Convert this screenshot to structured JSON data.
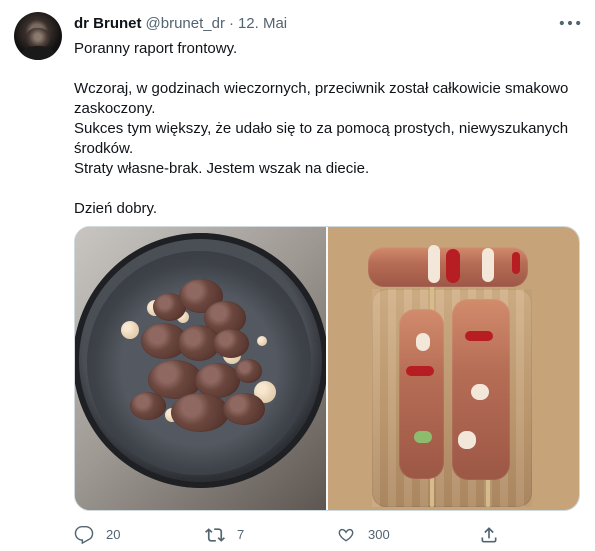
{
  "author": {
    "name": "dr Brunet",
    "handle": "@brunet_dr",
    "separator": "·",
    "date": "12. Mai"
  },
  "tweet": {
    "lines": [
      "Poranny raport frontowy.",
      "",
      "Wczoraj, w godzinach wieczornych, przeciwnik został całkowicie smakowo zaskoczony.",
      "Sukces tym większy, że udało się to za pomocą prostych, niewyszukanych środków.",
      "Straty własne-brak. Jestem wszak na diecie.",
      "",
      "Dzień dobry."
    ]
  },
  "actions": {
    "reply": {
      "count": "20",
      "icon": "reply-icon"
    },
    "retweet": {
      "count": "7",
      "icon": "retweet-icon"
    },
    "like": {
      "count": "300",
      "icon": "heart-icon"
    },
    "share": {
      "icon": "share-icon"
    }
  },
  "menu": {
    "more_icon": "more-icon"
  }
}
